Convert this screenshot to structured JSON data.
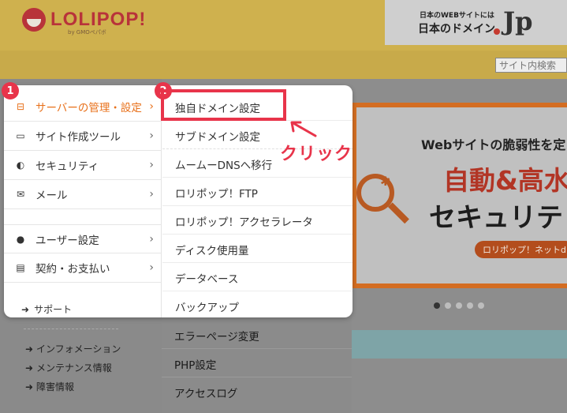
{
  "header": {
    "logo_text": "LOLIPOP!",
    "logo_sub": "by GMOペパボ",
    "jp_banner_line1": "日本のWEBサイトには",
    "jp_banner_line2": "日本のドメイン",
    "jp_logo": "Jp"
  },
  "search": {
    "placeholder": "サイト内検索"
  },
  "menu": {
    "col1": [
      {
        "label": "サーバーの管理・設定",
        "icon": "server-icon",
        "active": true
      },
      {
        "label": "サイト作成ツール",
        "icon": "laptop-icon"
      },
      {
        "label": "セキュリティ",
        "icon": "shield-icon"
      },
      {
        "label": "メール",
        "icon": "mail-icon"
      },
      {
        "label": "ユーザー設定",
        "icon": "user-icon"
      },
      {
        "label": "契約・お支払い",
        "icon": "credit-card-icon"
      }
    ],
    "support": "サポート",
    "col2": [
      "独自ドメイン設定",
      "サブドメイン設定",
      "ムームーDNSへ移行",
      "ロリポップ！FTP",
      "ロリポップ！アクセラレータ",
      "ディスク使用量",
      "データベース",
      "バックアップ"
    ],
    "col2_overflow": [
      "エラーページ変更",
      "PHP設定",
      "アクセスログ"
    ]
  },
  "background": {
    "links": [
      "インフォメーション",
      "メンテナンス情報",
      "障害情報"
    ],
    "banner_line1": "Webサイトの脆弱性を定",
    "banner_line2": "自動&高水",
    "banner_line3": "セキュリテ",
    "banner_pill": "ロリポップ！ネットd"
  },
  "annotations": {
    "badge1": "1",
    "badge2": "2",
    "click_label": "クリック"
  },
  "colors": {
    "accent": "#e8701a",
    "annotation": "#e8344a",
    "header": "#cfb14e"
  }
}
